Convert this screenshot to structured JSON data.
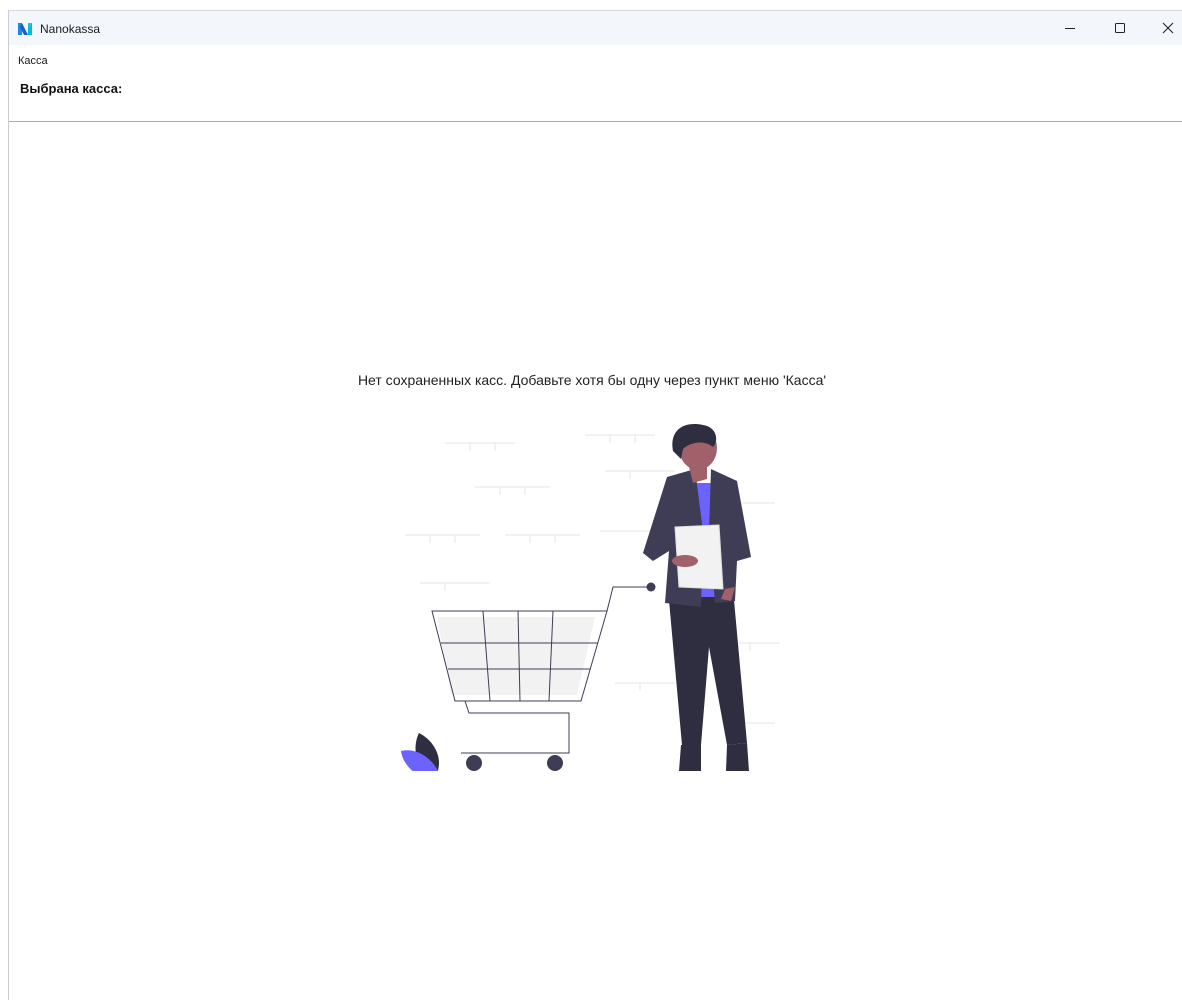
{
  "window": {
    "title": "Nanokassa",
    "controls": {
      "minimize": "minimize",
      "maximize": "maximize",
      "close": "close"
    }
  },
  "menu": {
    "items": [
      {
        "label": "Касса"
      }
    ]
  },
  "status": {
    "selected_label": "Выбрана касса:"
  },
  "empty_state": {
    "message": "Нет сохраненных касс. Добавьте хотя бы одну через пункт меню 'Касса'",
    "illustration": "person-with-shopping-cart"
  },
  "colors": {
    "accent": "#6c63ff",
    "dark_figure": "#2f2e41",
    "jacket": "#3f3d56",
    "skin": "#a0616a",
    "light_gray": "#f2f2f2",
    "logo_blue": "#1e88e5",
    "logo_teal": "#00bcd4"
  }
}
